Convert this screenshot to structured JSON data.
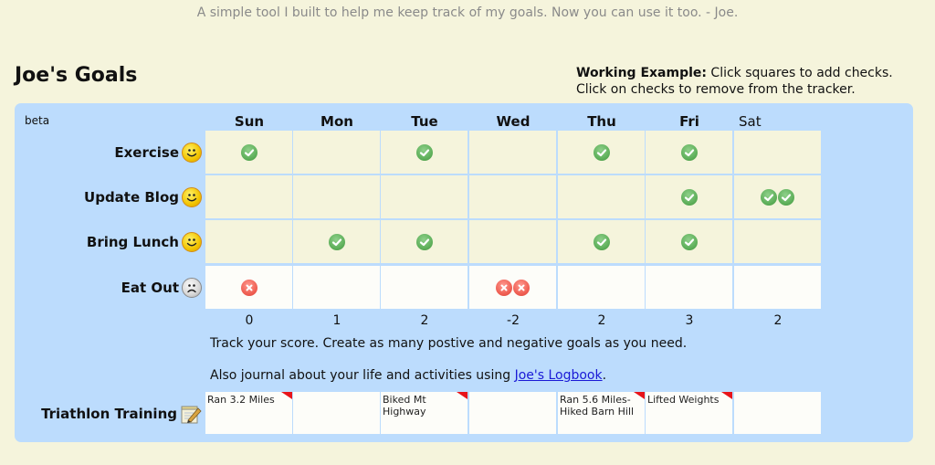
{
  "tagline": "A simple tool I built to help me keep track of my goals. Now you can use it too. - Joe.",
  "page_title": "Joe's Goals",
  "instructions": {
    "bold": "Working Example:",
    "line1": " Click squares to add checks.",
    "line2": "Click on checks to remove from the tracker."
  },
  "tracker": {
    "beta_label": "beta",
    "days": [
      "Sun",
      "Mon",
      "Tue",
      "Wed",
      "Thu",
      "Fri",
      "Sat"
    ],
    "goals": [
      {
        "name": "Exercise",
        "type": "positive",
        "icon": "happy-face-icon",
        "marks": [
          1,
          0,
          1,
          0,
          1,
          1,
          0
        ]
      },
      {
        "name": "Update Blog",
        "type": "positive",
        "icon": "happy-face-icon",
        "marks": [
          0,
          0,
          0,
          0,
          0,
          1,
          2
        ]
      },
      {
        "name": "Bring Lunch",
        "type": "positive",
        "icon": "happy-face-icon",
        "marks": [
          0,
          1,
          1,
          0,
          1,
          1,
          0
        ]
      },
      {
        "name": "Eat Out",
        "type": "negative",
        "icon": "sad-face-icon",
        "marks": [
          1,
          0,
          0,
          2,
          0,
          0,
          0
        ]
      }
    ],
    "scores": [
      "0",
      "1",
      "2",
      "-2",
      "2",
      "3",
      "2"
    ],
    "note1": "Track your score. Create as many postive and negative goals as you need.",
    "note2_prefix": "Also journal about your life and activities using ",
    "note2_link": "Joe's Logbook",
    "note2_suffix": ".",
    "log": {
      "name": "Triathlon Training",
      "icon": "notepad-icon",
      "entries": [
        {
          "text": "Ran 3.2 Miles",
          "flag": true
        },
        {
          "text": "",
          "flag": false
        },
        {
          "text": "Biked Mt Highway",
          "flag": true
        },
        {
          "text": "",
          "flag": false
        },
        {
          "text": "Ran 5.6 Miles- Hiked Barn Hill",
          "flag": true
        },
        {
          "text": "Lifted Weights",
          "flag": true
        },
        {
          "text": "",
          "flag": false
        }
      ]
    }
  },
  "colors": {
    "page_bg": "#f5f4dc",
    "panel_bg": "#bcdcfd",
    "positive_cell": "#f5f4dc",
    "negative_cell": "#fdfdf9",
    "check": "#5cae58",
    "cross": "#ee5c50",
    "link": "#1a1ad6",
    "flag": "#e8141a"
  }
}
